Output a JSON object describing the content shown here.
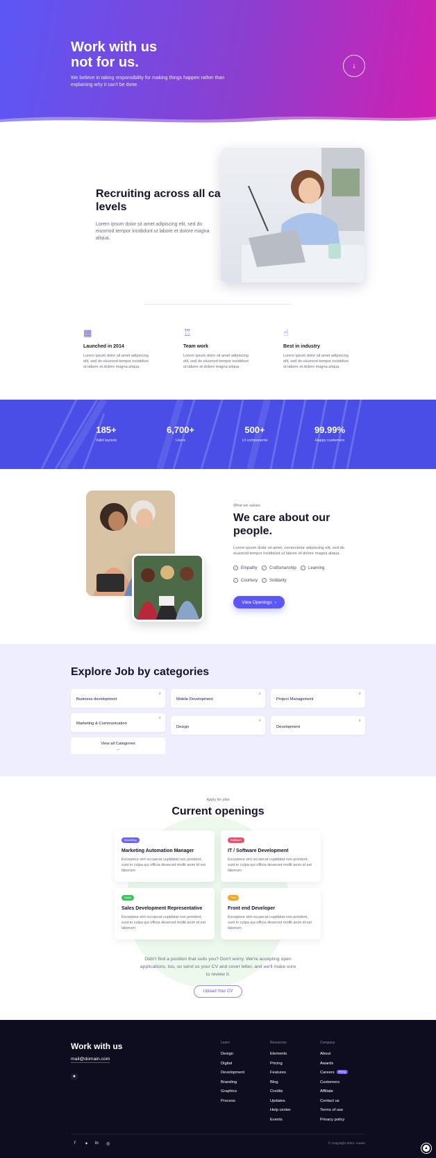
{
  "hero": {
    "title_line1": "Work with us",
    "title_line2": "not for us.",
    "subtitle": "We believe in taking responsibility for making things happen rather than explaining why it can't be done.",
    "scroll_icon": "arrow-down-icon"
  },
  "recruit": {
    "title": "Recruiting across all career levels",
    "description": "Lorem ipsum dolor sit amet adipiscing elit, sed do eiusmod tempor incididunt ut labore et dolore magna aliqua."
  },
  "features": [
    {
      "icon": "building-icon",
      "title": "Launched in 2014",
      "desc": "Lorem ipsum dolor sit amet adipiscing elit, sed do eiusmod tempor incididunt ut labore et dolore magna aliqua."
    },
    {
      "icon": "team-icon",
      "title": "Team work",
      "desc": "Lorem ipsum dolor sit amet adipiscing elit, sed do eiusmod tempor incididunt ut labore et dolore magna aliqua."
    },
    {
      "icon": "thumbs-up-icon",
      "title": "Best in industry",
      "desc": "Lorem ipsum dolor sit amet adipiscing elit, sed do eiusmod tempor incididunt ut labore et dolore magna aliqua."
    }
  ],
  "stats": [
    {
      "value": "185+",
      "label": "Valid layouts"
    },
    {
      "value": "6,700+",
      "label": "Users"
    },
    {
      "value": "500+",
      "label": "UI components"
    },
    {
      "value": "99.99%",
      "label": "Happy customers"
    }
  ],
  "care": {
    "eyebrow": "What we values",
    "title": "We care about our people.",
    "description": "Lorem ipsum dolor sit amet, consectetur adipiscing elit, sed do eiusmod tempor incididunt ut labore et dolore magna aliqua.",
    "values": [
      "Empathy",
      "Craftsmanship",
      "Learning",
      "Courtesy",
      "Solidarity"
    ],
    "button": "View Openings"
  },
  "categories": {
    "title": "Explore Job by categories",
    "items": [
      "Business development",
      "Mobile Development",
      "Project Management",
      "Marketing & Communication",
      "Design",
      "Development"
    ],
    "view_all": "View all Categories"
  },
  "openings": {
    "eyebrow": "Apply for jobs",
    "title": "Current openings",
    "jobs": [
      {
        "badge": "Marketing",
        "badge_color": "#6c63ff",
        "title": "Marketing Automation Manager",
        "desc": "Excepteur sint occaecat cupidatat non proident, sunt in culpa qui officia deserunt mollit anim id est laborum"
      },
      {
        "badge": "Software",
        "badge_color": "#f0506e",
        "title": "IT / Software Development",
        "desc": "Excepteur sint occaecat cupidatat non proident, sunt in culpa qui officia deserunt mollit anim id est laborum"
      },
      {
        "badge": "Sales",
        "badge_color": "#35c75a",
        "title": "Sales Development Representative",
        "desc": "Excepteur sint occaecat cupidatat non proident, sunt in culpa qui officia deserunt mollit anim id est laborum"
      },
      {
        "badge": "Tech",
        "badge_color": "#f5a623",
        "title": "Front end Developer",
        "desc": "Excepteur sint occaecat cupidatat non proident, sunt in culpa qui officia deserunt mollit anim id est laborum"
      }
    ],
    "not_found": "Didn't find a position that suits you? Don't worry. We're accepting open applications, too, so send us your CV and cover letter, and we'll make sure to review it.",
    "upload_button": "Upload Your CV"
  },
  "footer": {
    "title": "Work with us",
    "email": "mail@domain.com",
    "columns": [
      {
        "heading": "Learn",
        "links": [
          "Design",
          "Digital",
          "Development",
          "Branding",
          "Graphics",
          "Process"
        ]
      },
      {
        "heading": "Resources",
        "links": [
          "Elements",
          "Pricing",
          "Features",
          "Blog",
          "Credits",
          "Updates",
          "Help center",
          "Events"
        ]
      },
      {
        "heading": "Company",
        "links": [
          "About",
          "Awards",
          "Careers",
          "Customers",
          "Affiliate",
          "Contact us",
          "Terms of use",
          "Privacy policy"
        ]
      }
    ],
    "hiring_badge": "Hiring",
    "social": [
      "facebook-icon",
      "twitter-icon",
      "linkedin-icon",
      "instagram-icon"
    ],
    "copyright": "© Copyright 2024. Axean"
  },
  "colors": {
    "primary": "#5b57f6",
    "stats_bg": "#4a4de6",
    "footer_bg": "#0e0c1f",
    "categories_bg": "#efeefe"
  }
}
